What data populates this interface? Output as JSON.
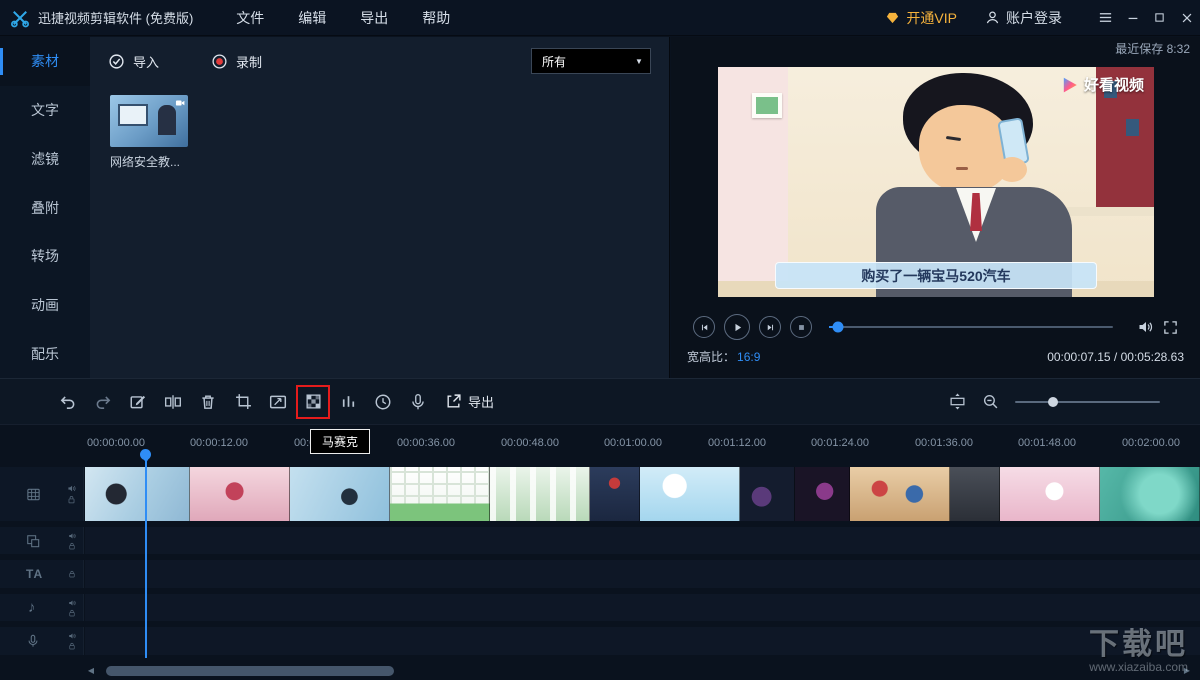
{
  "colors": {
    "accent": "#2f8df5",
    "vip_orange": "#f5b23c",
    "highlight_red": "#e51c1c"
  },
  "titlebar": {
    "app_title": "迅捷视频剪辑软件 (免费版)",
    "menus": [
      {
        "label": "文件"
      },
      {
        "label": "编辑"
      },
      {
        "label": "导出"
      },
      {
        "label": "帮助"
      }
    ],
    "vip_label": "开通VIP",
    "login_label": "账户登录"
  },
  "status": {
    "recent_save": "最近保存 8:32"
  },
  "sidebar": {
    "items": [
      {
        "label": "素材"
      },
      {
        "label": "文字"
      },
      {
        "label": "滤镜"
      },
      {
        "label": "叠附"
      },
      {
        "label": "转场"
      },
      {
        "label": "动画"
      },
      {
        "label": "配乐"
      }
    ]
  },
  "media": {
    "import_label": "导入",
    "record_label": "录制",
    "filter_value": "所有",
    "dropdown_arrow": "▼",
    "items": [
      {
        "title": "网络安全教..."
      }
    ]
  },
  "preview": {
    "logo_text": "好看视频",
    "subtitle": "购买了一辆宝马520汽车",
    "aspect_label": "宽高比：",
    "aspect_value": "16:9",
    "time_display": "00:00:07.15 / 00:05:28.63"
  },
  "toolbar": {
    "export_label": "导出",
    "mosaic_tooltip": "马赛克"
  },
  "timeline": {
    "ruler_labels": [
      "00:00:00.00",
      "00:00:12.00",
      "00:00:24.00",
      "00:00:36.00",
      "00:00:48.00",
      "00:01:00.00",
      "00:01:12.00",
      "00:01:24.00",
      "00:01:36.00",
      "00:01:48.00",
      "00:02:00.00"
    ],
    "text_track_label": "TA",
    "music_note": "♪",
    "scroll_left_arrow": "◀",
    "scroll_right_arrow": "▶"
  },
  "watermark": {
    "title": "下载吧",
    "url": "www.xiazaiba.com"
  }
}
